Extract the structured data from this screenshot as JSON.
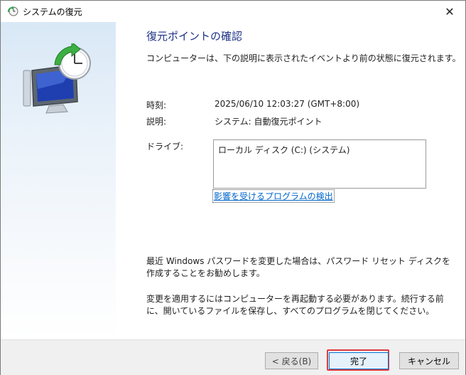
{
  "window": {
    "title": "システムの復元",
    "close_glyph": "✕",
    "icon": "system-restore-icon"
  },
  "main": {
    "heading": "復元ポイントの確認",
    "intro": "コンピューターは、下の説明に表示されたイベントより前の状態に復元されます。",
    "time_label": "時刻:",
    "time_value": "2025/06/10 12:03:27 (GMT+8:00)",
    "description_label": "説明:",
    "description_value": "システム: 自動復元ポイント",
    "drives_label": "ドライブ:",
    "drives": [
      "ローカル ディスク (C:) (システム)"
    ],
    "scan_link": "影響を受けるプログラムの検出",
    "password_note": "最近 Windows パスワードを変更した場合は、パスワード リセット ディスクを作成することをお勧めします。",
    "restart_note": "変更を適用するにはコンピューターを再起動する必要があります。続行する前に、開いているファイルを保存し、すべてのプログラムを閉じてください。"
  },
  "footer": {
    "back_label": "< 戻る(B)",
    "finish_label": "完了",
    "cancel_label": "キャンセル"
  },
  "colors": {
    "heading": "#1e3287",
    "link": "#0066cc",
    "highlight": "#e0393e"
  }
}
